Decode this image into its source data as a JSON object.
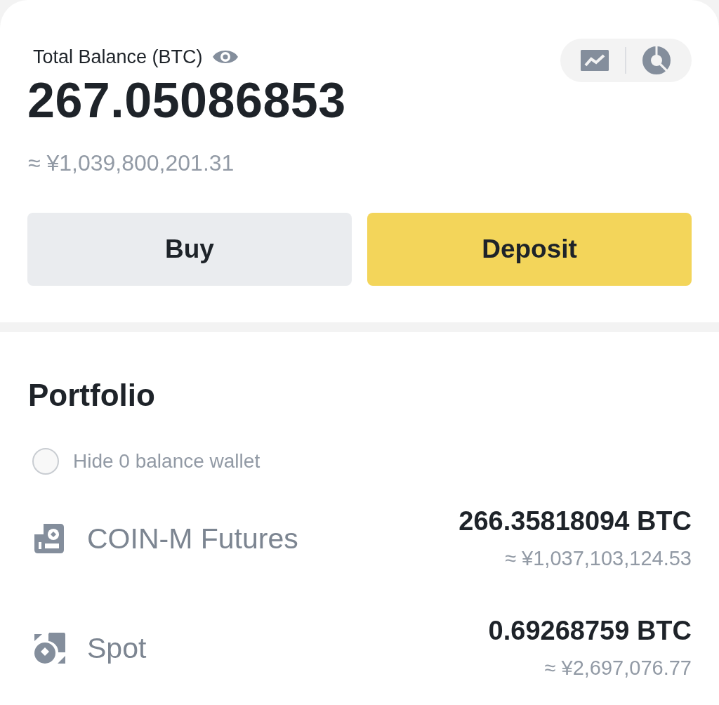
{
  "balance": {
    "label": "Total Balance (BTC)",
    "amount": "267.05086853",
    "fiat": "≈ ¥1,039,800,201.31"
  },
  "actions": [
    {
      "label": "Buy",
      "kind": "secondary"
    },
    {
      "label": "Deposit",
      "kind": "primary"
    }
  ],
  "portfolio": {
    "title": "Portfolio",
    "hide_zero": {
      "label": "Hide 0 balance wallet",
      "checked": false
    },
    "wallets": [
      {
        "kind": "futures",
        "name": "COIN-M Futures",
        "amount": "266.35818094 BTC",
        "fiat": "≈ ¥1,037,103,124.53"
      },
      {
        "kind": "spot",
        "name": "Spot",
        "amount": "0.69268759 BTC",
        "fiat": "≈ ¥2,697,076.77"
      }
    ]
  }
}
